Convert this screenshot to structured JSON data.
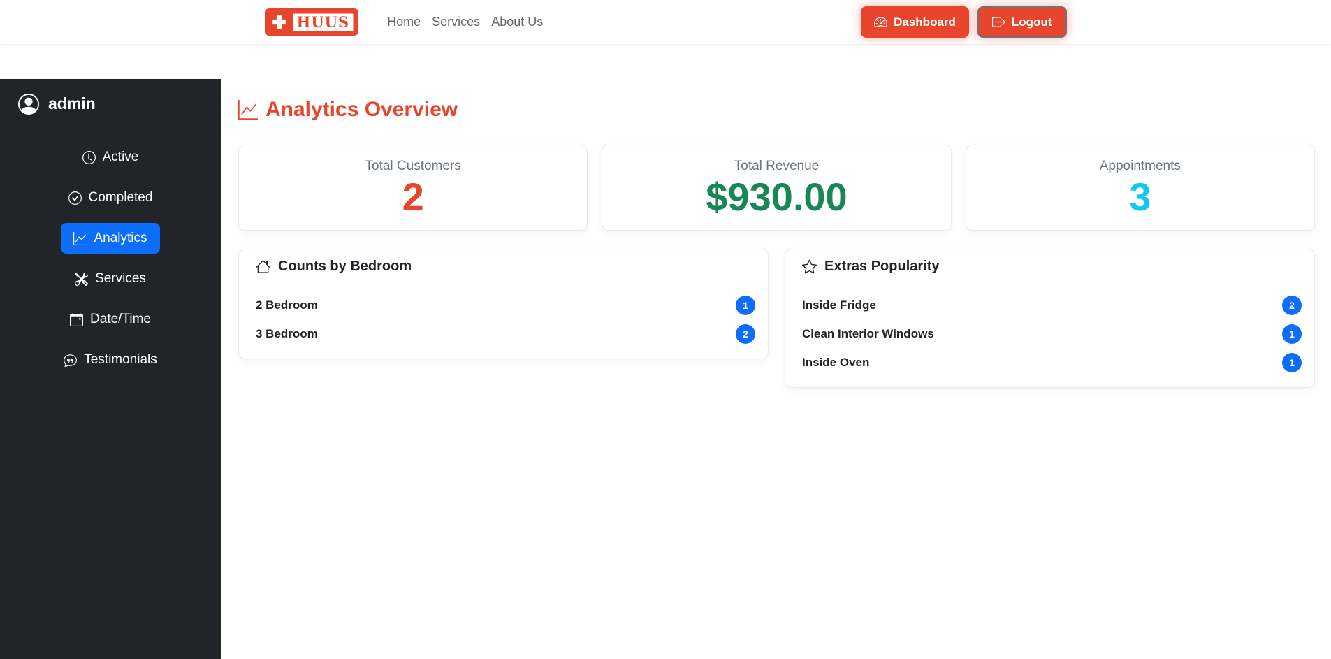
{
  "navbar": {
    "brand": "HUUS",
    "links": [
      {
        "label": "Home"
      },
      {
        "label": "Services"
      },
      {
        "label": "About Us"
      }
    ],
    "buttons": {
      "dashboard": "Dashboard",
      "logout": "Logout"
    }
  },
  "sidebar": {
    "username": "admin",
    "items": [
      {
        "label": "Active",
        "icon": "clock-icon",
        "active": false
      },
      {
        "label": "Completed",
        "icon": "check-circle-icon",
        "active": false
      },
      {
        "label": "Analytics",
        "icon": "graph-up-icon",
        "active": true
      },
      {
        "label": "Services",
        "icon": "tools-icon",
        "active": false
      },
      {
        "label": "Date/Time",
        "icon": "calendar-icon",
        "active": false
      },
      {
        "label": "Testimonials",
        "icon": "chat-quote-icon",
        "active": false
      }
    ]
  },
  "main": {
    "title": "Analytics Overview",
    "stats": [
      {
        "label": "Total Customers",
        "value": "2",
        "color": "#e8462c"
      },
      {
        "label": "Total Revenue",
        "value": "$930.00",
        "color": "#198754"
      },
      {
        "label": "Appointments",
        "value": "3",
        "color": "#0dcaf0"
      }
    ],
    "panels": [
      {
        "title": "Counts by Bedroom",
        "icon": "house-icon",
        "items": [
          {
            "label": "2 Bedroom",
            "count": "1"
          },
          {
            "label": "3 Bedroom",
            "count": "2"
          }
        ]
      },
      {
        "title": "Extras Popularity",
        "icon": "star-icon",
        "items": [
          {
            "label": "Inside Fridge",
            "count": "2"
          },
          {
            "label": "Clean Interior Windows",
            "count": "1"
          },
          {
            "label": "Inside Oven",
            "count": "1"
          }
        ]
      }
    ]
  },
  "colors": {
    "accent_red": "#e8462c",
    "primary_blue": "#0d6efd",
    "success_green": "#198754",
    "info_cyan": "#0dcaf0",
    "sidebar_bg": "#212529",
    "muted_text": "#6c757d"
  }
}
